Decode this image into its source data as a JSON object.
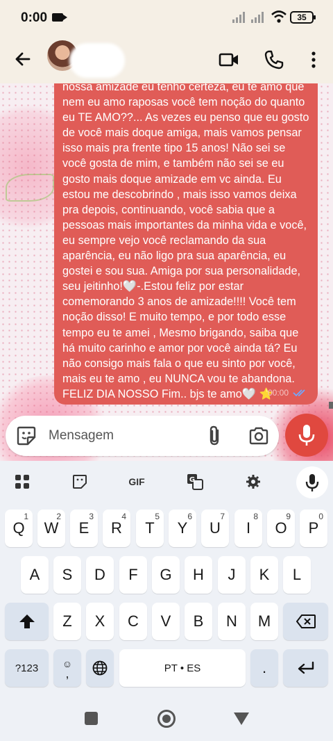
{
  "status_bar": {
    "time": "0:00",
    "battery": "35"
  },
  "chat": {
    "message_text": "nossa amizade eu tenho certeza, eu te amo que nem eu amo raposas você tem noção do quanto eu TE AMO??... As vezes eu penso que eu gosto de você mais doque amiga, mais vamos pensar isso mais pra frente tipo 15 anos! Não sei se você gosta de mim, e também não sei se eu gosto mais doque amizade em vc ainda. Eu estou me descobrindo , mais isso vamos deixa pra depois, continuando, você sabia que a pessoas mais importantes da minha vida e você, eu sempre vejo você reclamando da sua aparência, eu não ligo pra sua aparência, eu gostei e sou sua. Amiga por sua personalidade, seu jeitinho!",
    "message_text_2": "-.Estou feliz por estar comemorando 3 anos de amizade!!!! Você tem noção disso! E muito tempo, e por todo esse tempo eu te amei , Mesmo brigando, saiba que há muito carinho e amor por você ainda tá? Eu não consigo mais fala o que eu sinto por você, mais eu te amo , eu NUNCA vou te abandona. FELIZ DIA NOSSO Fim.. bjs te amo",
    "heart_emoji": "🤍",
    "star_emoji": "⭐",
    "message_time": "00:00",
    "bubble_color": "#e05c57"
  },
  "composer": {
    "placeholder": "Mensagem"
  },
  "keyboard": {
    "toolbar_gif": "GIF",
    "row1": [
      {
        "k": "Q",
        "n": "1"
      },
      {
        "k": "W",
        "n": "2"
      },
      {
        "k": "E",
        "n": "3"
      },
      {
        "k": "R",
        "n": "4"
      },
      {
        "k": "T",
        "n": "5"
      },
      {
        "k": "Y",
        "n": "6"
      },
      {
        "k": "U",
        "n": "7"
      },
      {
        "k": "I",
        "n": "8"
      },
      {
        "k": "O",
        "n": "9"
      },
      {
        "k": "P",
        "n": "0"
      }
    ],
    "row2": [
      "A",
      "S",
      "D",
      "F",
      "G",
      "H",
      "J",
      "K",
      "L"
    ],
    "row3": [
      "Z",
      "X",
      "C",
      "V",
      "B",
      "N",
      "M"
    ],
    "symbols_label": "?123",
    "comma_label": ",",
    "space_label": "PT • ES",
    "period_label": "."
  },
  "colors": {
    "accent_red": "#e0483f",
    "keyboard_bg": "#eef1f6",
    "header_bg": "#f5efe5"
  }
}
